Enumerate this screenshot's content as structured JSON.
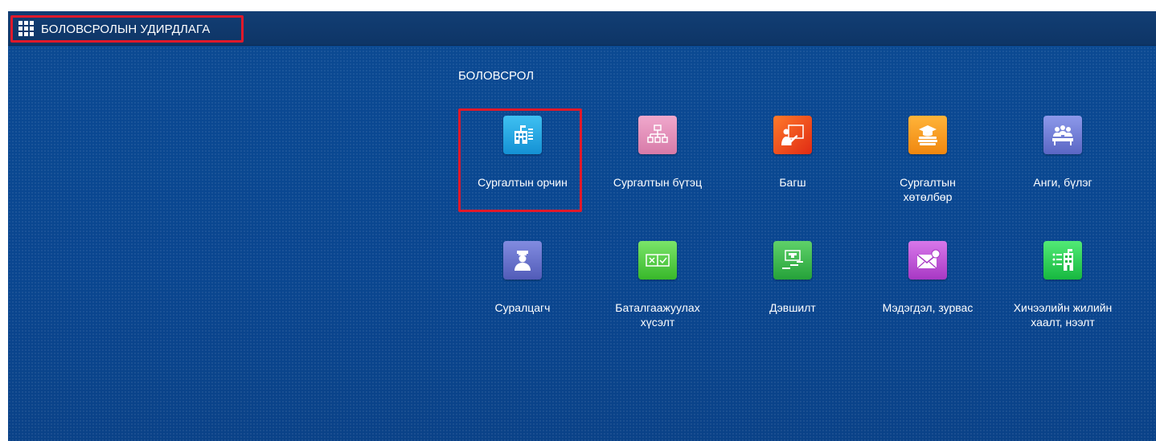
{
  "header": {
    "app_title": "БОЛОВСРОЛЫН УДИРДЛАГА"
  },
  "section": {
    "title": "БОЛОВСРОЛ"
  },
  "tiles": [
    {
      "label": "Сургалтын орчин",
      "icon": "school-building-icon",
      "color": "#1aa3e0",
      "selected": true
    },
    {
      "label": "Сургалтын бүтэц",
      "icon": "org-structure-icon",
      "color": "#e58fb8",
      "selected": false
    },
    {
      "label": "Багш",
      "icon": "teacher-board-icon",
      "color": "#f14a1d",
      "selected": false
    },
    {
      "label": "Сургалтын\nхөтөлбөр",
      "icon": "graduation-books-icon",
      "color": "#f79a1c",
      "selected": false
    },
    {
      "label": "Анги, бүлэг",
      "icon": "group-class-icon",
      "color": "#7280d8",
      "selected": false
    },
    {
      "label": "Суралцагч",
      "icon": "student-graduate-icon",
      "color": "#6a74c8",
      "selected": false
    },
    {
      "label": "Баталгаажуулах\nхүсэлт",
      "icon": "approval-checkbox-icon",
      "color": "#4fcf42",
      "selected": false
    },
    {
      "label": "Дэвшилт",
      "icon": "progress-steps-icon",
      "color": "#38b748",
      "selected": false
    },
    {
      "label": "Мэдэгдэл, зурвас",
      "icon": "message-envelope-icon",
      "color": "#c24fd8",
      "selected": false
    },
    {
      "label": "Хичээлийн жилийн\nхаалт, нээлт",
      "icon": "school-year-list-icon",
      "color": "#2ed457",
      "selected": false
    }
  ]
}
